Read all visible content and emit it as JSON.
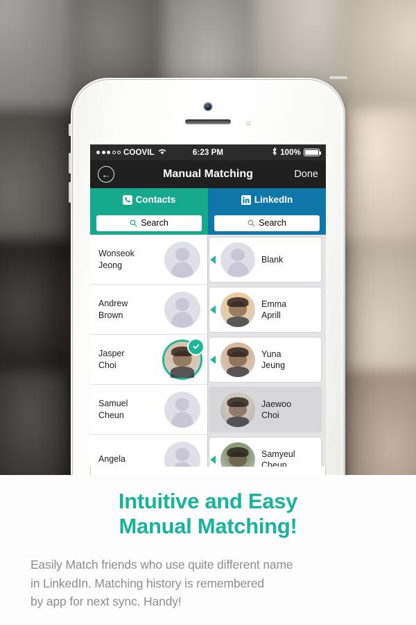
{
  "background": {
    "description": "blurred photo collage of people",
    "tiles": [
      "#8d8b88",
      "#6b6762",
      "#9a9691",
      "#b8b2a8",
      "#c9bfae",
      "#55514d",
      "#3e3a37",
      "#7d7872",
      "#a79e92",
      "#d8ccb8",
      "#2e2b29",
      "#4a4542",
      "#6e6862",
      "#8f857a",
      "#c4b9a6",
      "#3a3734",
      "#2a2826",
      "#545049",
      "#7a7065",
      "#a8998a"
    ]
  },
  "phone": {
    "model": "white iphone",
    "camera_icon": "camera-icon",
    "speaker_icon": "speaker-grille-icon",
    "sensor_icon": "proximity-sensor-icon"
  },
  "statusbar": {
    "signal_dots_filled": 3,
    "signal_dots_total": 5,
    "carrier": "COOVIL",
    "wifi_icon": "wifi-icon",
    "time": "6:23 PM",
    "bluetooth_icon": "bluetooth-icon",
    "battery_percent": "100%",
    "battery_icon": "battery-full-icon"
  },
  "navbar": {
    "back_icon": "back-arrow-icon",
    "title": "Manual Matching",
    "done_label": "Done"
  },
  "tabs": [
    {
      "label": "Contacts",
      "icon": "phone-icon",
      "color": "#16a98c",
      "active": true
    },
    {
      "label": "LinkedIn",
      "icon": "linkedin-icon",
      "color": "#0e76a8",
      "active": false
    }
  ],
  "search": {
    "left_placeholder": "Search",
    "right_placeholder": "Search",
    "icon": "search-icon"
  },
  "contacts_list": [
    {
      "name_line1": "Wonseok",
      "name_line2": "Jeong",
      "avatar": "placeholder",
      "selected": false
    },
    {
      "name_line1": "Andrew",
      "name_line2": "Brown",
      "avatar": "placeholder",
      "selected": false
    },
    {
      "name_line1": "Jasper",
      "name_line2": "Choi",
      "avatar": "photo-man-glasses-suit",
      "avatar_color": "#d8c3ab",
      "selected": true
    },
    {
      "name_line1": "Samuel",
      "name_line2": "Cheun",
      "avatar": "placeholder",
      "selected": false
    },
    {
      "name_line1": "Angela",
      "name_line2": "",
      "avatar": "placeholder",
      "selected": false
    }
  ],
  "linkedin_list": [
    {
      "name_line1": "Blank",
      "name_line2": "",
      "avatar": "placeholder",
      "avatar_color": "#e0dfe8",
      "matched": false,
      "connector": true
    },
    {
      "name_line1": "Emma",
      "name_line2": "Aprill",
      "avatar": "photo-woman-blonde",
      "avatar_color": "#e8c9a0",
      "matched": false,
      "connector": true
    },
    {
      "name_line1": "Yuna",
      "name_line2": "Jeung",
      "avatar": "photo-child-girl",
      "avatar_color": "#d8b89a",
      "matched": false,
      "connector": true
    },
    {
      "name_line1": "Jaewoo",
      "name_line2": "Choi",
      "avatar": "photo-man-glasses-suit",
      "avatar_color": "#cfc6bb",
      "matched": true,
      "connector": false
    },
    {
      "name_line1": "Samyeul",
      "name_line2": "Cheun",
      "avatar": "photo-man-glasses-outdoor",
      "avatar_color": "#8a9a7a",
      "matched": false,
      "connector": true
    }
  ],
  "caption": {
    "headline_line1": "Intuitive and Easy",
    "headline_line2": "Manual Matching!",
    "body_line1": "Easily Match friends who use quite different name",
    "body_line2": "in LinkedIn. Matching history is remembered",
    "body_line3": "by app for next sync. Handy!",
    "headline_color": "#17b39b",
    "body_color": "#8d8d8d"
  }
}
